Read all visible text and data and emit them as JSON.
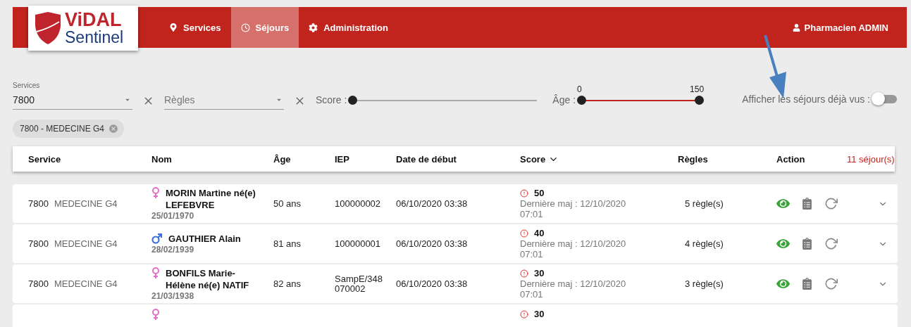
{
  "logo": {
    "line1": "ViDAL",
    "line2": "Sentinel"
  },
  "nav": [
    {
      "label": "Services",
      "selected": false
    },
    {
      "label": "Séjours",
      "selected": true
    },
    {
      "label": "Administration",
      "selected": false
    }
  ],
  "user": {
    "label": "Pharmacien ADMIN"
  },
  "filters": {
    "services": {
      "label": "Services",
      "value": "7800"
    },
    "regles": {
      "placeholder": "Règles"
    },
    "score": {
      "label": "Score :",
      "level": 0
    },
    "age": {
      "label": "Âge :",
      "min": "0",
      "max": "150",
      "level": 1
    },
    "seen_toggle": {
      "label": "Afficher les séjours déjà vus :",
      "on": false
    },
    "chips": [
      {
        "label": "7800 - MEDECINE G4"
      }
    ]
  },
  "table": {
    "columns": [
      "Service",
      "Nom",
      "Âge",
      "IEP",
      "Date de début",
      "Score",
      "Règles",
      "Action"
    ],
    "count": "11 séjour(s)",
    "rows": [
      {
        "code": "7800",
        "service": "MEDECINE G4",
        "kind": "female",
        "name": "MORIN Martine né(e) LEFEBVRE",
        "birth": "25/01/1970",
        "age": "50 ans",
        "iep": "100000002",
        "date": "06/10/2020 03:38",
        "score": "50",
        "update": "Dernière maj : 12/10/2020 07:01",
        "rules": "5 règle(s)"
      },
      {
        "code": "7800",
        "service": "MEDECINE G4",
        "kind": "male",
        "name": "GAUTHIER Alain",
        "birth": "28/02/1939",
        "age": "81 ans",
        "iep": "100000001",
        "date": "06/10/2020 03:38",
        "score": "40",
        "update": "Dernière maj : 12/10/2020 07:01",
        "rules": "4 règle(s)"
      },
      {
        "code": "7800",
        "service": "MEDECINE G4",
        "kind": "female",
        "name": "BONFILS Marie-Hélène né(e) NATIF",
        "birth": "21/03/1938",
        "age": "82 ans",
        "iep": "SampE/348070002",
        "date": "06/10/2020 03:38",
        "score": "30",
        "update": "Dernière maj : 12/10/2020 07:01",
        "rules": "3 règle(s)"
      }
    ],
    "partial_row": {
      "kind": "female",
      "score": "30"
    }
  }
}
